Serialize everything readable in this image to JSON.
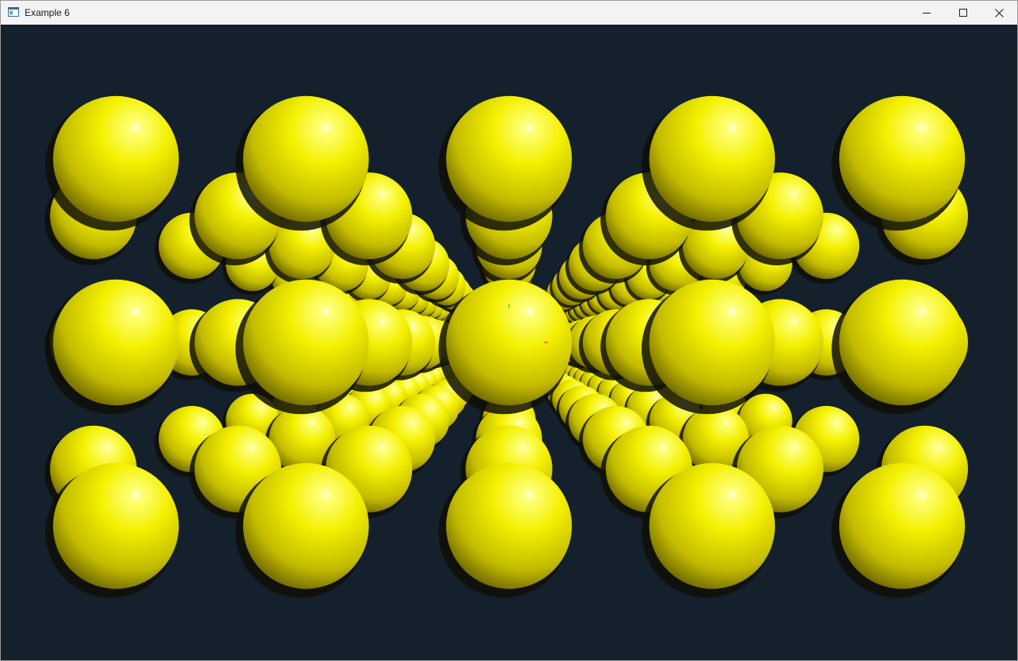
{
  "window": {
    "title": "Example 6",
    "icon": "app-window-icon",
    "controls": {
      "minimize": "minimize-icon",
      "maximize": "maximize-icon",
      "close": "close-icon"
    }
  },
  "scene": {
    "description_color_background": "#14202b",
    "sphere_color": "#f4f000",
    "sphere_shadow_color": "#0f0f08",
    "axis_colors": {
      "x": "#e21b1b",
      "y": "#18c21a"
    }
  }
}
